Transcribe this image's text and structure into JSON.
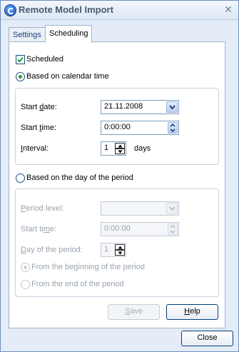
{
  "window": {
    "title": "Remote Model Import"
  },
  "tabs": [
    {
      "label": "Settings",
      "active": false
    },
    {
      "label": "Scheduling",
      "active": true
    }
  ],
  "scheduled": {
    "label": "Scheduled",
    "checked": true
  },
  "calendar_option": {
    "label": "Based on calendar time",
    "selected": true
  },
  "calendar_group": {
    "start_date": {
      "label_pre": "Start ",
      "label_u": "d",
      "label_post": "ate:",
      "value": "21.11.2008"
    },
    "start_time": {
      "label_pre": "Start ",
      "label_u": "t",
      "label_post": "ime:",
      "value": "0:00:00"
    },
    "interval": {
      "label_pre": "",
      "label_u": "I",
      "label_post": "nterval:",
      "value": "1",
      "unit": "days"
    }
  },
  "period_option": {
    "label": "Based on the day of the period",
    "selected": false
  },
  "period_group": {
    "period_level": {
      "label_pre": "",
      "label_u": "P",
      "label_post": "eriod level:",
      "value": ""
    },
    "start_time": {
      "label_pre": "Start ti",
      "label_u": "m",
      "label_post": "e:",
      "value": "0:00:00"
    },
    "day_of_period": {
      "label_pre": "",
      "label_u": "D",
      "label_post": "ay of the period:",
      "value": "1"
    },
    "from_beginning": {
      "label": "From the beginning of the period",
      "selected": true
    },
    "from_end": {
      "label": "From the end of the period",
      "selected": false
    }
  },
  "buttons": {
    "save": {
      "pre": "",
      "u": "S",
      "post": "ave"
    },
    "help": {
      "pre": "",
      "u": "H",
      "post": "elp"
    },
    "close": {
      "label": "Close"
    }
  }
}
